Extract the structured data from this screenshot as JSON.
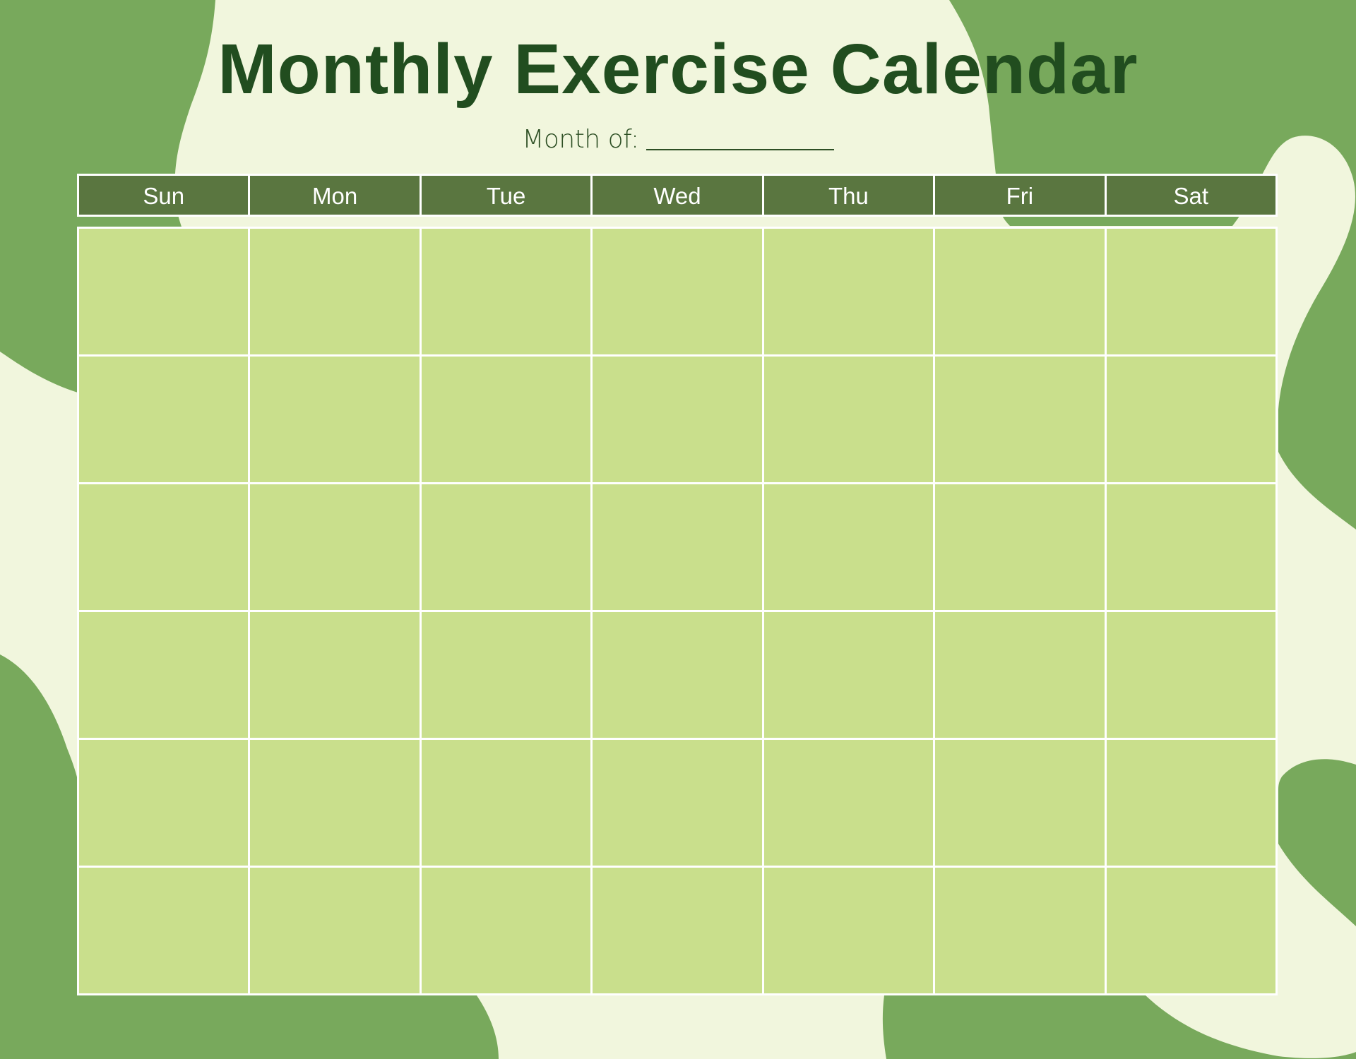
{
  "document": {
    "title": "Monthly Exercise Calendar",
    "subtitle_label": "Month of:",
    "month_value": ""
  },
  "calendar": {
    "weekdays": [
      "Sun",
      "Mon",
      "Tue",
      "Wed",
      "Thu",
      "Fri",
      "Sat"
    ],
    "weeks": [
      [
        "",
        "",
        "",
        "",
        "",
        "",
        ""
      ],
      [
        "",
        "",
        "",
        "",
        "",
        "",
        ""
      ],
      [
        "",
        "",
        "",
        "",
        "",
        "",
        ""
      ],
      [
        "",
        "",
        "",
        "",
        "",
        "",
        ""
      ],
      [
        "",
        "",
        "",
        "",
        "",
        "",
        ""
      ],
      [
        "",
        "",
        "",
        "",
        "",
        "",
        ""
      ]
    ]
  },
  "colors": {
    "background": "#f1f6dd",
    "blob": "#78a95c",
    "title": "#214d1f",
    "header_fill": "#5a7640",
    "cell_fill": "#c9df8c",
    "grid_lines": "#ffffff"
  }
}
